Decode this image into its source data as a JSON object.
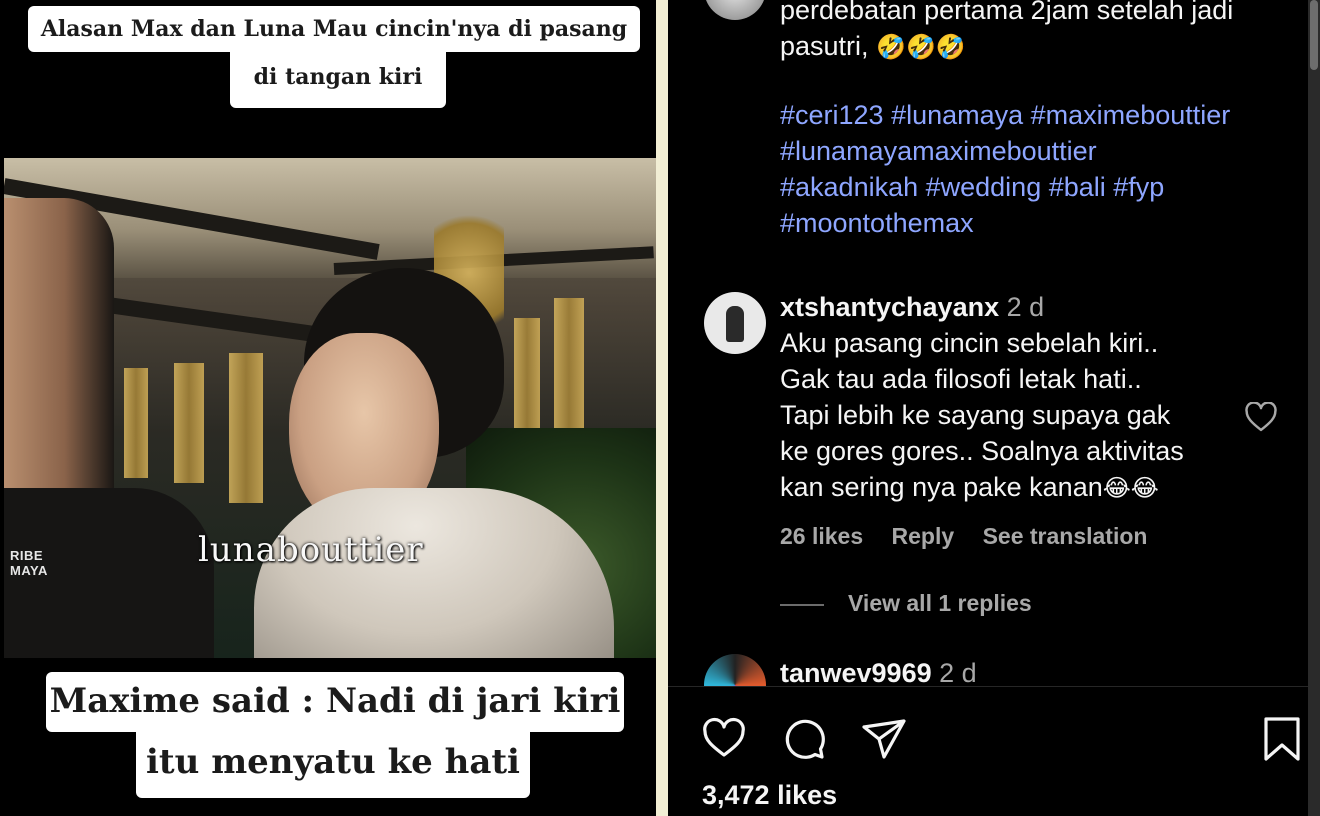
{
  "video": {
    "caption_top_line1": "Alasan Max dan Luna Mau cincin'nya di pasang",
    "caption_top_line2": "di tangan kiri",
    "watermark": "lunabouttier",
    "channel_logo_line1": "RIBE",
    "channel_logo_line2": "MAYA",
    "caption_bottom_line1": "Maxime said : Nadi di jari kiri",
    "caption_bottom_line2": "itu menyatu ke hati"
  },
  "post_caption": {
    "line1": "perdebatan pertama 2jam setelah jadi",
    "line2_text": "pasutri,",
    "line2_emoji": "🤣🤣🤣",
    "hashtags_line1": "#ceri123 #lunamaya #maximebouttier",
    "hashtags_line2": "#lunamayamaximebouttier",
    "hashtags_line3": "#akadnikah #wedding #bali #fyp",
    "hashtags_line4": "#moontothemax"
  },
  "comments": [
    {
      "username": "xtshantychayanx",
      "time": "2 d",
      "lines": [
        "Aku pasang cincin sebelah kiri..",
        "Gak tau ada filosofi letak hati..",
        "Tapi lebih ke sayang supaya gak",
        "ke gores gores.. Soalnya aktivitas",
        "kan sering nya pake kanan"
      ],
      "trailing_emoji": "😂😂",
      "likes": "26 likes",
      "reply_label": "Reply",
      "translate_label": "See translation",
      "view_replies": "View all 1 replies"
    },
    {
      "username": "tanwev9969",
      "time": "2 d"
    }
  ],
  "actions": {
    "like_icon": "heart-icon",
    "comment_icon": "comment-icon",
    "share_icon": "send-icon",
    "save_icon": "bookmark-icon",
    "likes_total": "3,472 likes"
  },
  "colors": {
    "background": "#000000",
    "hashtag": "#8ea6ff",
    "secondary_text": "#a8a8a8"
  }
}
